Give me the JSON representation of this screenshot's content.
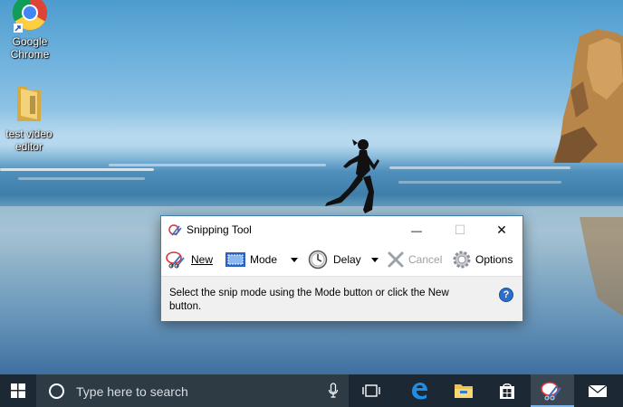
{
  "desktop": {
    "icons": [
      {
        "name": "chrome",
        "label": "Google Chrome"
      },
      {
        "name": "folder",
        "label": "test video editor"
      }
    ]
  },
  "window": {
    "title": "Snipping Tool",
    "controls": {
      "minimize": "—",
      "maximize": "☐",
      "close": "✕"
    },
    "toolbar": {
      "new_label": "New",
      "mode_label": "Mode",
      "delay_label": "Delay",
      "cancel_label": "Cancel",
      "options_label": "Options"
    },
    "message": "Select the snip mode using the Mode button or click the New button.",
    "help": "?"
  },
  "taskbar": {
    "search_placeholder": "Type here to search",
    "items": [
      "task-view",
      "edge",
      "file-explorer",
      "store",
      "snipping-tool",
      "mail"
    ]
  },
  "colors": {
    "taskbar": "#1c2833",
    "search_box": "#2e3a44",
    "window_border": "#3c7fb1",
    "accent": "#2e6ec9"
  }
}
